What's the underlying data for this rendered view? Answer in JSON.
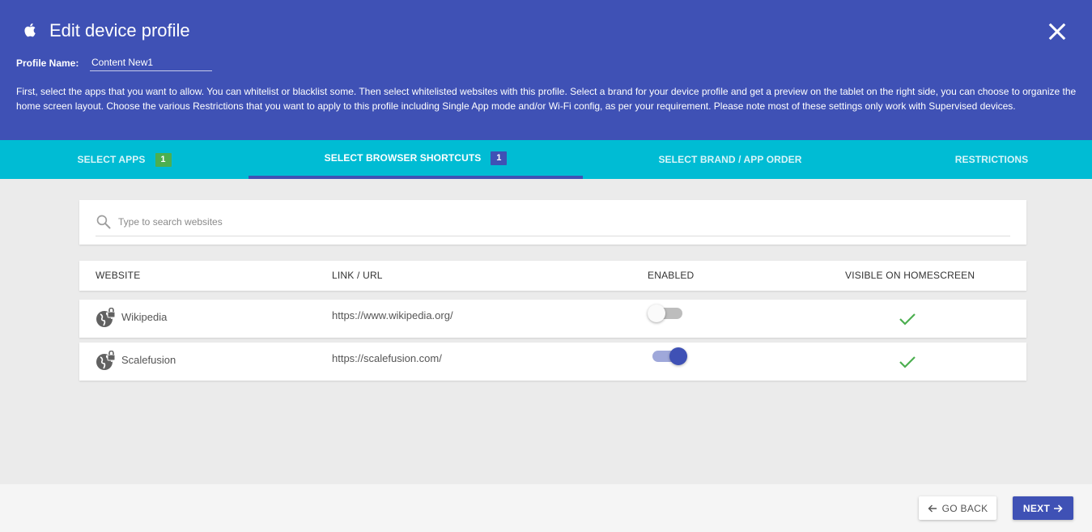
{
  "header": {
    "title": "Edit device profile",
    "profile_name_label": "Profile Name:",
    "profile_name_value": "Content New1",
    "description": "First, select the apps that you want to allow. You can whitelist or blacklist some. Then select whitelisted websites with this profile. Select a brand for your device profile and get a preview on the tablet on the right side, you can choose to organize the home screen layout. Choose the various Restrictions that you want to apply to this profile including Single App mode and/or Wi-Fi config, as per your requirement. Please note most of these settings only work with Supervised devices.",
    "icons": {
      "brand": "apple-icon",
      "close": "close-icon"
    },
    "background_color": "#3f51b5"
  },
  "tabs": [
    {
      "label": "SELECT APPS",
      "count": "1",
      "active": false
    },
    {
      "label": "SELECT BROWSER SHORTCUTS",
      "count": "1",
      "active": true
    },
    {
      "label": "SELECT BRAND / APP ORDER",
      "active": false
    },
    {
      "label": "RESTRICTIONS",
      "active": false
    }
  ],
  "tabs_color": "#00bcd4",
  "search": {
    "placeholder": "Type to search websites",
    "value": ""
  },
  "table": {
    "columns": [
      "WEBSITE",
      "LINK / URL",
      "ENABLED",
      "VISIBLE ON HOMESCREEN"
    ],
    "rows": [
      {
        "website": "Wikipedia",
        "url": "https://www.wikipedia.org/",
        "enabled": false,
        "visible": true
      },
      {
        "website": "Scalefusion",
        "url": "https://scalefusion.com/",
        "enabled": true,
        "visible": true
      }
    ]
  },
  "footer": {
    "back_label": "GO BACK",
    "next_label": "NEXT",
    "accent_color": "#3f51b5"
  }
}
